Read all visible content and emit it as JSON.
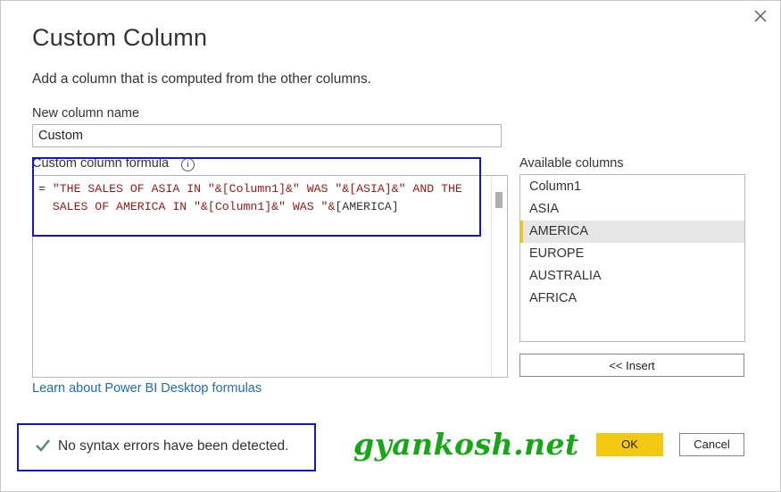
{
  "dialog": {
    "title": "Custom Column",
    "subtitle": "Add a column that is computed from the other columns.",
    "close_icon": "close-icon"
  },
  "new_column": {
    "label": "New column name",
    "value": "Custom"
  },
  "formula": {
    "label": "Custom column formula",
    "info_icon": "info-icon",
    "line1": {
      "eq": "= ",
      "text": "\"THE SALES OF ASIA IN \"&[Column1]&\" WAS \"&[ASIA]&\" AND THE"
    },
    "line2": {
      "text": "  SALES OF AMERICA IN \"&[Column1]&\" WAS \"&",
      "cursor_part": "[AMERICA]"
    }
  },
  "available_columns": {
    "label": "Available columns",
    "items": [
      "Column1",
      "ASIA",
      "AMERICA",
      "EUROPE",
      "AUSTRALIA",
      "AFRICA"
    ],
    "selected": "AMERICA"
  },
  "insert_label": "<< Insert",
  "learn_link": "Learn about Power BI Desktop formulas",
  "status": {
    "icon": "check-icon",
    "text": "No syntax errors have been detected."
  },
  "watermark": "gyankosh.net",
  "buttons": {
    "ok": "OK",
    "cancel": "Cancel"
  },
  "colors": {
    "accent": "#f2c811",
    "link": "#1a6eb5",
    "formula_string": "#a31515",
    "highlight_box": "#1515c8",
    "watermark": "#14a814",
    "check": "#4a8b6a"
  }
}
